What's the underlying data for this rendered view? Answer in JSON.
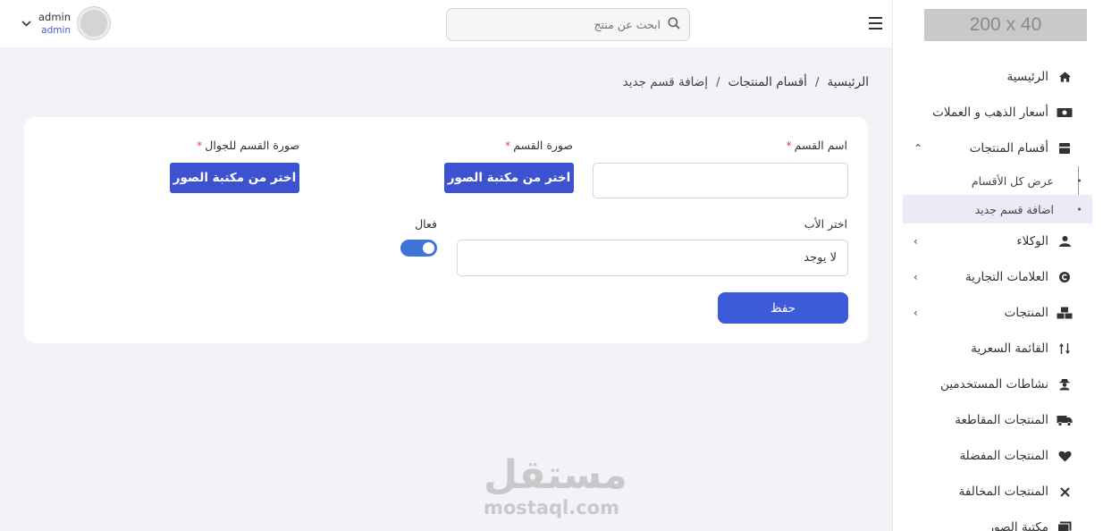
{
  "logo": {
    "text": "200 x 40"
  },
  "sidebar": {
    "items": [
      {
        "label": "الرئيسية",
        "icon": "home-icon"
      },
      {
        "label": "أسعار الذهب و العملات",
        "icon": "money-icon"
      },
      {
        "label": "أقسام المنتجات",
        "icon": "box-icon",
        "expanded": true,
        "children": [
          {
            "label": "عرض كل الأقسام"
          },
          {
            "label": "اضافة قسم جديد",
            "active": true
          }
        ]
      },
      {
        "label": "الوكلاء",
        "icon": "users-icon"
      },
      {
        "label": "العلامات التجارية",
        "icon": "copyright-icon"
      },
      {
        "label": "المنتجات",
        "icon": "boxes-icon"
      },
      {
        "label": "القائمة السعرية",
        "icon": "sort-icon"
      },
      {
        "label": "نشاطات المستخدمين",
        "icon": "user-secret-icon"
      },
      {
        "label": "المنتجات المقاطعة",
        "icon": "truck-icon"
      },
      {
        "label": "المنتجات المفضلة",
        "icon": "heart-icon"
      },
      {
        "label": "المنتجات المخالفة",
        "icon": "times-icon"
      },
      {
        "label": "مكتبة الصور",
        "icon": "images-icon"
      }
    ]
  },
  "topbar": {
    "search_placeholder": "ابحث عن منتج",
    "user_name": "admin",
    "user_role": "admin"
  },
  "breadcrumb": {
    "home": "الرئيسية",
    "section": "أقسام المنتجات",
    "current": "إضافة قسم جديد",
    "separator": "/"
  },
  "form": {
    "name_label": "اسم القسم",
    "image_label": "صورة القسم",
    "mobile_image_label": "صورة القسم للجوال",
    "required_mark": "*",
    "library_button": "اختر من مكتبة الصور",
    "parent_label": "اختر الأب",
    "parent_value": "لا يوجد",
    "active_label": "فعال",
    "active": true,
    "save_button": "حفظ"
  },
  "watermark": {
    "arabic": "مستقل",
    "latin": "mostaql.com"
  }
}
